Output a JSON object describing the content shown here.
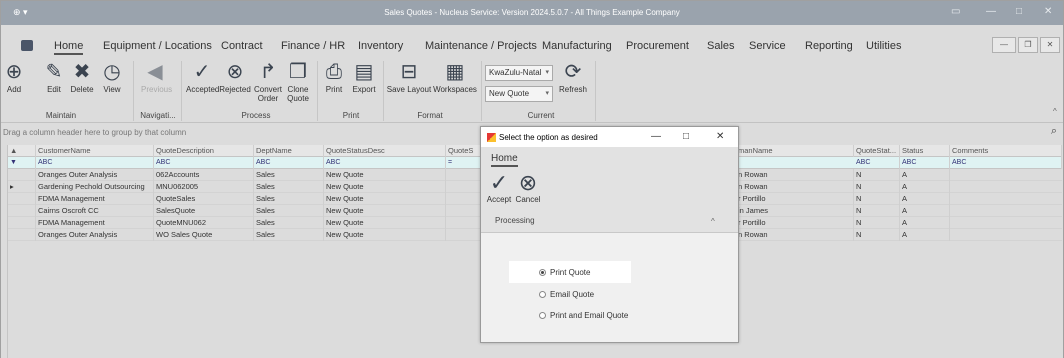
{
  "window": {
    "title": "Sales Quotes - Nucleus Service: Version 2024.5.0.7 - All Things Example Company",
    "app_icon": "app-menu-icon"
  },
  "menu": {
    "tabs": [
      "Home",
      "Equipment / Locations",
      "Contract",
      "Finance / HR",
      "Inventory",
      "Maintenance / Projects",
      "Manufacturing",
      "Procurement",
      "Sales",
      "Service",
      "Reporting",
      "Utilities"
    ],
    "active": "Home"
  },
  "ribbon": {
    "maintain": {
      "label": "Maintain",
      "buttons": [
        "Add",
        "Edit",
        "Delete",
        "View"
      ]
    },
    "navigation": {
      "label": "Navigati...",
      "buttons": [
        "Previous"
      ]
    },
    "process": {
      "label": "Process",
      "buttons": [
        "Accepted",
        "Rejected",
        "Convert Order",
        "Clone Quote"
      ]
    },
    "print": {
      "label": "Print",
      "buttons": [
        "Print",
        "Export"
      ]
    },
    "format": {
      "label": "Format",
      "buttons": [
        "Save Layout",
        "Workspaces"
      ]
    },
    "current": {
      "label": "Current",
      "region": "KwaZulu-Natal",
      "status": "New Quote",
      "refresh": "Refresh"
    }
  },
  "grid": {
    "group_hint": "Drag a column header here to group by that column",
    "columns": [
      "CustomerName",
      "QuoteDescription",
      "DeptName",
      "QuoteStatusDesc",
      "QuoteS",
      "",
      "manName",
      "QuoteStat...",
      "Status",
      "Comments"
    ],
    "filter_token": "ABC",
    "rows": [
      {
        "customer": "Oranges Outer Analysis",
        "desc": "062Accounts",
        "dept": "Sales",
        "qstatus": "New Quote",
        "sales": "n Rowan",
        "qs": "N",
        "status": "A"
      },
      {
        "customer": "Gardening Pechold Outsourcing",
        "desc": "MNU062005",
        "dept": "Sales",
        "qstatus": "New Quote",
        "sales": "n Rowan",
        "qs": "N",
        "status": "A"
      },
      {
        "customer": "FDMA Management",
        "desc": "QuoteSales",
        "dept": "Sales",
        "qstatus": "New Quote",
        "sales": "r Portillo",
        "qs": "N",
        "status": "A"
      },
      {
        "customer": "Cairns Oscroft CC",
        "desc": "SalesQuote",
        "dept": "Sales",
        "qstatus": "New Quote",
        "sales": "in James",
        "qs": "N",
        "status": "A"
      },
      {
        "customer": "FDMA Management",
        "desc": "QuoteMNU062",
        "dept": "Sales",
        "qstatus": "New Quote",
        "sales": "r Portillo",
        "qs": "N",
        "status": "A"
      },
      {
        "customer": "Oranges Outer Analysis",
        "desc": "WO Sales Quote",
        "dept": "Sales",
        "qstatus": "New Quote",
        "sales": "n Rowan",
        "qs": "N",
        "status": "A"
      }
    ]
  },
  "dialog": {
    "title": "Select the option as desired",
    "tab": "Home",
    "accept": "Accept",
    "cancel": "Cancel",
    "group": "Processing",
    "options": [
      "Print Quote",
      "Email Quote",
      "Print and Email Quote"
    ],
    "selected": "Print Quote"
  }
}
